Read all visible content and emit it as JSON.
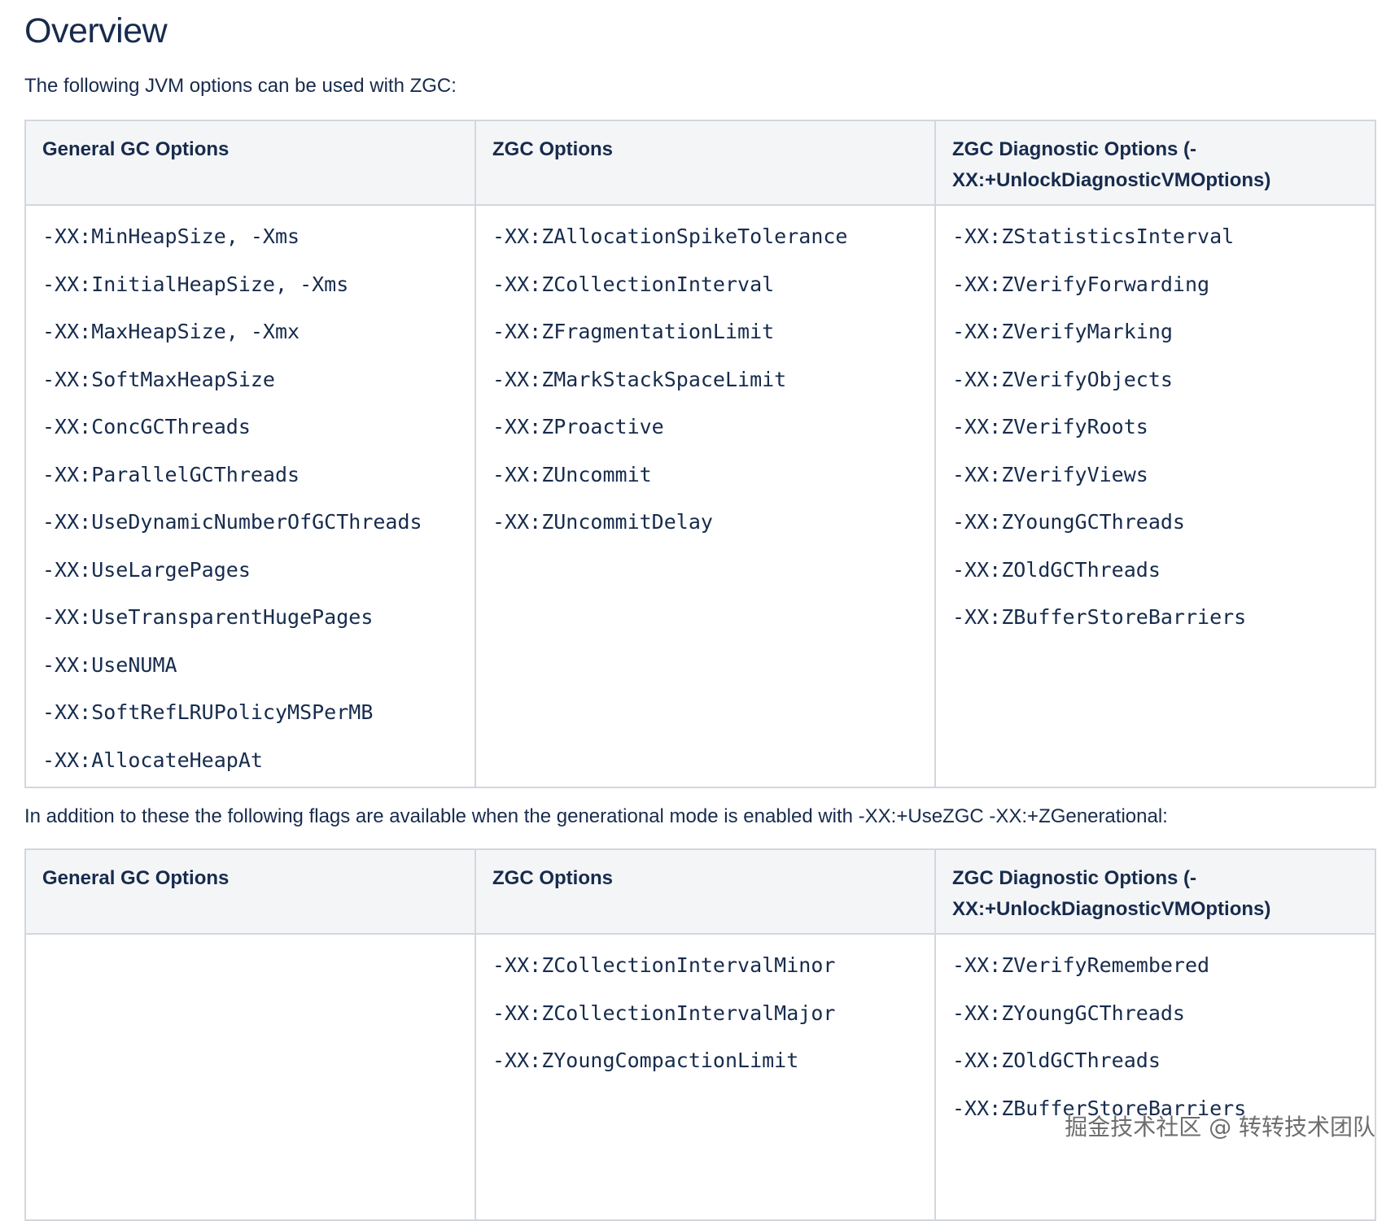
{
  "title": "Overview",
  "intro": "The following JVM options can be used with ZGC:",
  "mid_text": "In addition to these the following flags are available when the generational mode is enabled with -XX:+UseZGC -XX:+ZGenerational:",
  "table1": {
    "headers": [
      "General GC Options",
      "ZGC Options",
      "ZGC Diagnostic Options (-XX:+UnlockDiagnosticVMOptions)"
    ],
    "columns": [
      [
        "-XX:MinHeapSize, -Xms",
        "-XX:InitialHeapSize, -Xms",
        "-XX:MaxHeapSize, -Xmx",
        "-XX:SoftMaxHeapSize",
        "-XX:ConcGCThreads",
        "-XX:ParallelGCThreads",
        "-XX:UseDynamicNumberOfGCThreads",
        "-XX:UseLargePages",
        "-XX:UseTransparentHugePages",
        "-XX:UseNUMA",
        "-XX:SoftRefLRUPolicyMSPerMB",
        "-XX:AllocateHeapAt"
      ],
      [
        "-XX:ZAllocationSpikeTolerance",
        "-XX:ZCollectionInterval",
        "-XX:ZFragmentationLimit",
        "-XX:ZMarkStackSpaceLimit",
        "-XX:ZProactive",
        "-XX:ZUncommit",
        "-XX:ZUncommitDelay"
      ],
      [
        "-XX:ZStatisticsInterval",
        "-XX:ZVerifyForwarding",
        "-XX:ZVerifyMarking",
        "-XX:ZVerifyObjects",
        "-XX:ZVerifyRoots",
        "-XX:ZVerifyViews",
        "-XX:ZYoungGCThreads",
        "-XX:ZOldGCThreads",
        "-XX:ZBufferStoreBarriers"
      ]
    ]
  },
  "table2": {
    "headers": [
      "General GC Options",
      "ZGC Options",
      "ZGC Diagnostic Options (-XX:+UnlockDiagnosticVMOptions)"
    ],
    "columns": [
      [],
      [
        "-XX:ZCollectionIntervalMinor",
        "-XX:ZCollectionIntervalMajor",
        "-XX:ZYoungCompactionLimit"
      ],
      [
        "-XX:ZVerifyRemembered",
        "-XX:ZYoungGCThreads",
        "-XX:ZOldGCThreads",
        "-XX:ZBufferStoreBarriers"
      ]
    ]
  },
  "watermark": "掘金技术社区 @ 转转技术团队"
}
